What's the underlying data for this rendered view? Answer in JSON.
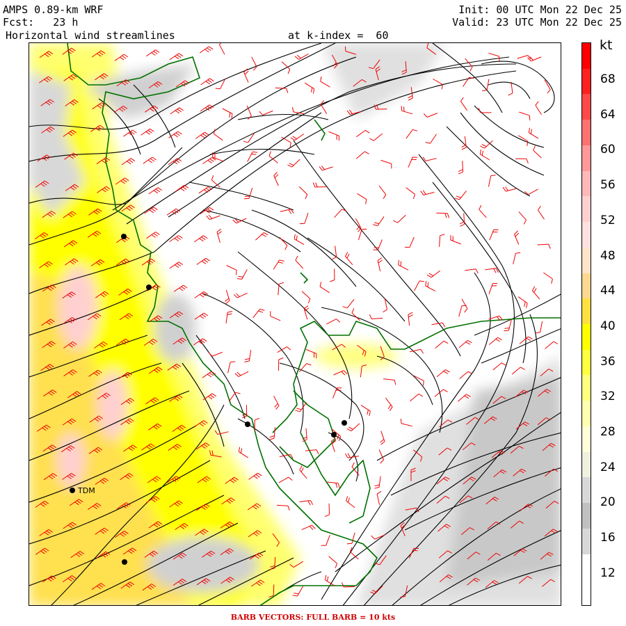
{
  "header": {
    "model": "AMPS 0.89-km WRF",
    "init": "Init: 00 UTC Mon 22 Dec 25",
    "fcst": "Fcst:   23 h",
    "valid": "Valid: 23 UTC Mon 22 Dec 25",
    "field": "Horizontal wind streamlines",
    "level": "at k-index =  60"
  },
  "colorbar": {
    "unit": "kt",
    "labels": [
      "68",
      "64",
      "60",
      "56",
      "52",
      "48",
      "44",
      "40",
      "36",
      "32",
      "28",
      "24",
      "20",
      "16",
      "12"
    ],
    "colors": [
      "#ff0000",
      "#ff2020",
      "#ff4848",
      "#ff7070",
      "#ff9898",
      "#ffb8b8",
      "#ffd0d0",
      "#ffe0e0",
      "#ffe4c8",
      "#ffd890",
      "#ffe040",
      "#ffff00",
      "#ffff40",
      "#ffff80",
      "#ffffb0",
      "#ffffd8",
      "#f0f0e0",
      "#d8d8d8",
      "#c0c0c0",
      "#d8d8d8",
      "#ffffff",
      "#ffffff"
    ]
  },
  "stations": [
    {
      "label": ""
    },
    {
      "label": ""
    },
    {
      "label": ""
    },
    {
      "label": ""
    },
    {
      "label": ""
    },
    {
      "label": "TDM"
    },
    {
      "label": ""
    }
  ],
  "footer": "BARB VECTORS:  FULL BARB = 10 kts"
}
